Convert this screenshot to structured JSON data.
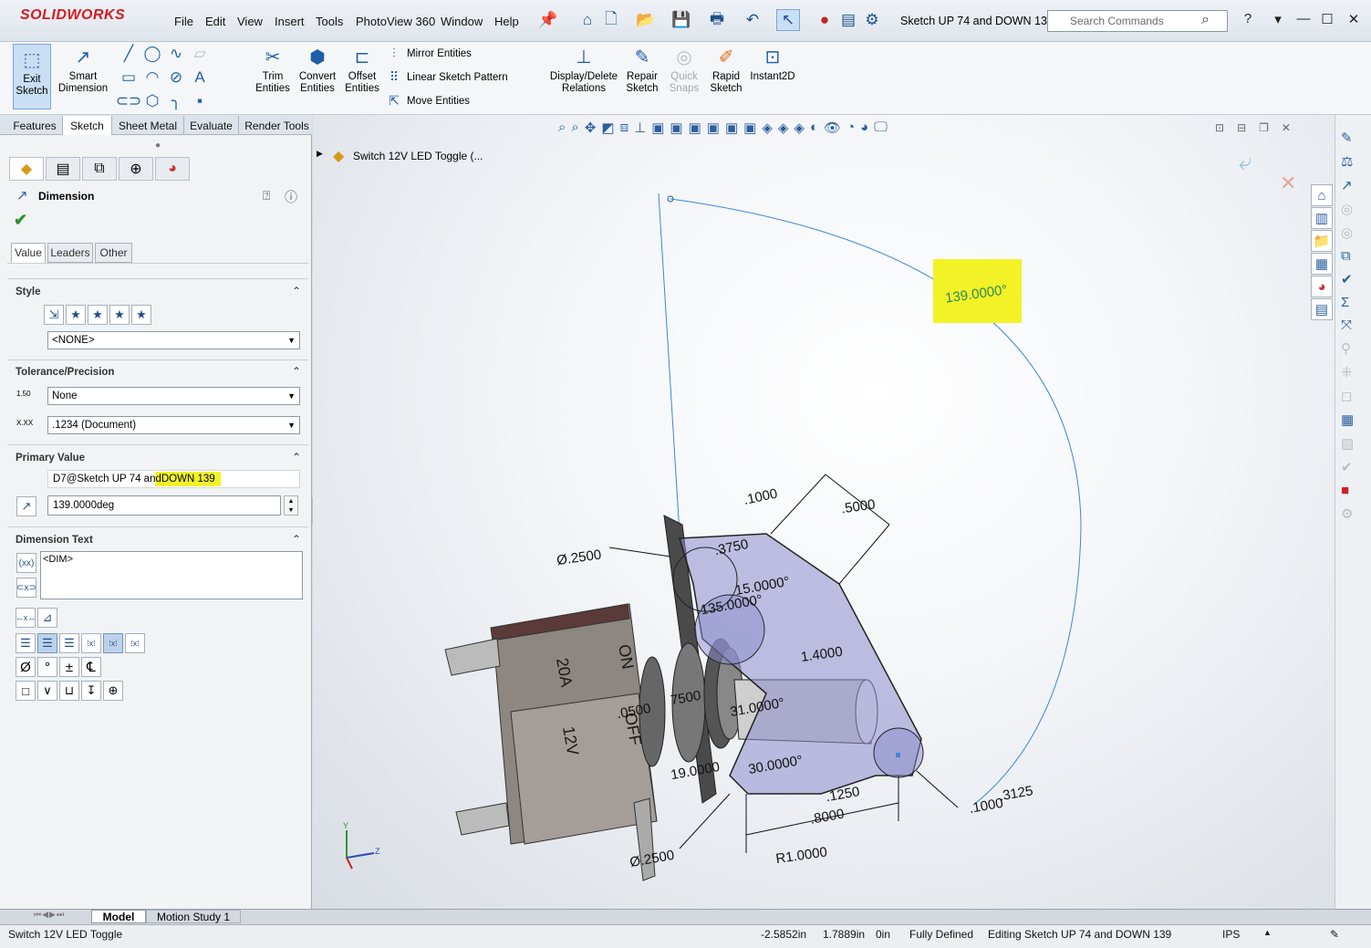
{
  "app": {
    "logo": "SOLIDWORKS",
    "doc_title": "Sketch UP 74 and DOWN 13..."
  },
  "menu": [
    "File",
    "Edit",
    "View",
    "Insert",
    "Tools",
    "PhotoView 360",
    "Window",
    "Help"
  ],
  "search": {
    "placeholder": "Search Commands"
  },
  "ribbon": {
    "exit_sketch": "Exit Sketch",
    "smart_dimension": "Smart Dimension",
    "trim_entities": "Trim Entities",
    "convert_entities": "Convert Entities",
    "offset_entities": "Offset Entities",
    "mirror_entities": "Mirror Entities",
    "linear_sketch_pattern": "Linear Sketch Pattern",
    "move_entities": "Move Entities",
    "display_delete_relations": "Display/Delete Relations",
    "repair_sketch": "Repair Sketch",
    "quick_snaps": "Quick Snaps",
    "rapid_sketch": "Rapid Sketch",
    "instant2d": "Instant2D"
  },
  "command_tabs": [
    "Features",
    "Sketch",
    "Sheet Metal",
    "Evaluate",
    "Render Tools"
  ],
  "property_manager": {
    "title": "Dimension",
    "tabs": [
      "Value",
      "Leaders",
      "Other"
    ],
    "style": {
      "heading": "Style",
      "value": "<NONE>"
    },
    "tolerance": {
      "heading": "Tolerance/Precision",
      "tolerance_type": "None",
      "precision": ".1234 (Document)",
      "tol_icon": "1.50",
      "prec_icon": "X.XX"
    },
    "primary_value": {
      "heading": "Primary Value",
      "name_prefix": "D7@Sketch UP 74 an",
      "name_mid": "d ",
      "name_highlight": "DOWN 139",
      "value": "139.0000deg"
    },
    "dimension_text": {
      "heading": "Dimension Text",
      "text": "<DIM>"
    },
    "symbols": [
      "Ø",
      "°",
      "±",
      "℄"
    ]
  },
  "feature_tree": {
    "root": "Switch 12V LED Toggle   (..."
  },
  "drawing": {
    "angle_main": "139.0000°",
    "dims": [
      ".1000",
      ".5000",
      ".3750",
      "Ø.2500",
      "15.0000°",
      "135.0000°",
      "1.4000",
      "31.0000°",
      "30.0000°",
      ".0500",
      "7500",
      "19.0000",
      ".1250",
      ".8000",
      "R1.0000",
      "Ø.2500",
      ".3125",
      ".1000"
    ],
    "switch_labels": [
      "ON",
      "OFF",
      "20A",
      "12V"
    ],
    "axes": {
      "x": "Z",
      "y": "Y"
    }
  },
  "bottom_tabs": [
    "Model",
    "Motion Study 1"
  ],
  "status": {
    "doc_name": "Switch 12V LED Toggle",
    "x": "-2.5852in",
    "y": "1.7889in",
    "z": "0in",
    "state": "Fully Defined",
    "editing": "Editing Sketch UP 74 and DOWN 139",
    "units": "IPS"
  },
  "colors": {
    "accent": "#1f5fa8",
    "highlight": "#f2f227",
    "sketch_fill": "#8c8ccc",
    "brand": "#d71920"
  }
}
